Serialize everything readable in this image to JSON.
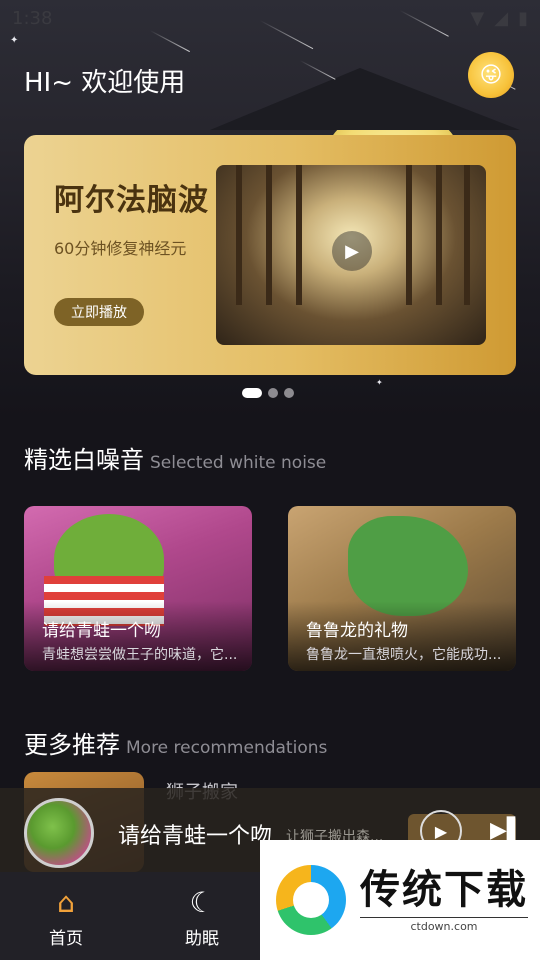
{
  "status_bar": {
    "time": "1:38"
  },
  "header": {
    "greeting": "HI~ 欢迎使用",
    "avatar_icon": "emoji-avatar"
  },
  "banner": {
    "title": "阿尔法脑波",
    "subtitle": "60分钟修复神经元",
    "play_button": "立即播放",
    "carousel_count": 3,
    "carousel_active": 0
  },
  "section_white_noise": {
    "title": "精选白噪音",
    "subtitle": "Selected white noise"
  },
  "cards": [
    {
      "title": "请给青蛙一个吻",
      "desc": "青蛙想尝尝做王子的味道，它..."
    },
    {
      "title": "鲁鲁龙的礼物",
      "desc": "鲁鲁龙一直想喷火，它能成功..."
    }
  ],
  "section_more": {
    "title": "更多推荐",
    "subtitle": "More recommendations"
  },
  "list": [
    {
      "title": "狮子搬家",
      "desc": "让狮子搬出森..."
    }
  ],
  "player": {
    "title": "请给青蛙一个吻"
  },
  "tabs": [
    {
      "label": "首页",
      "icon": "home-icon"
    },
    {
      "label": "助眠",
      "icon": "sleep-moon-icon"
    }
  ],
  "watermark": {
    "name": "传统下载",
    "url": "ctdown.com"
  },
  "colors": {
    "banner_gold": "#e4bd63",
    "background": "#15141a",
    "tab_active": "#f2a23a"
  }
}
